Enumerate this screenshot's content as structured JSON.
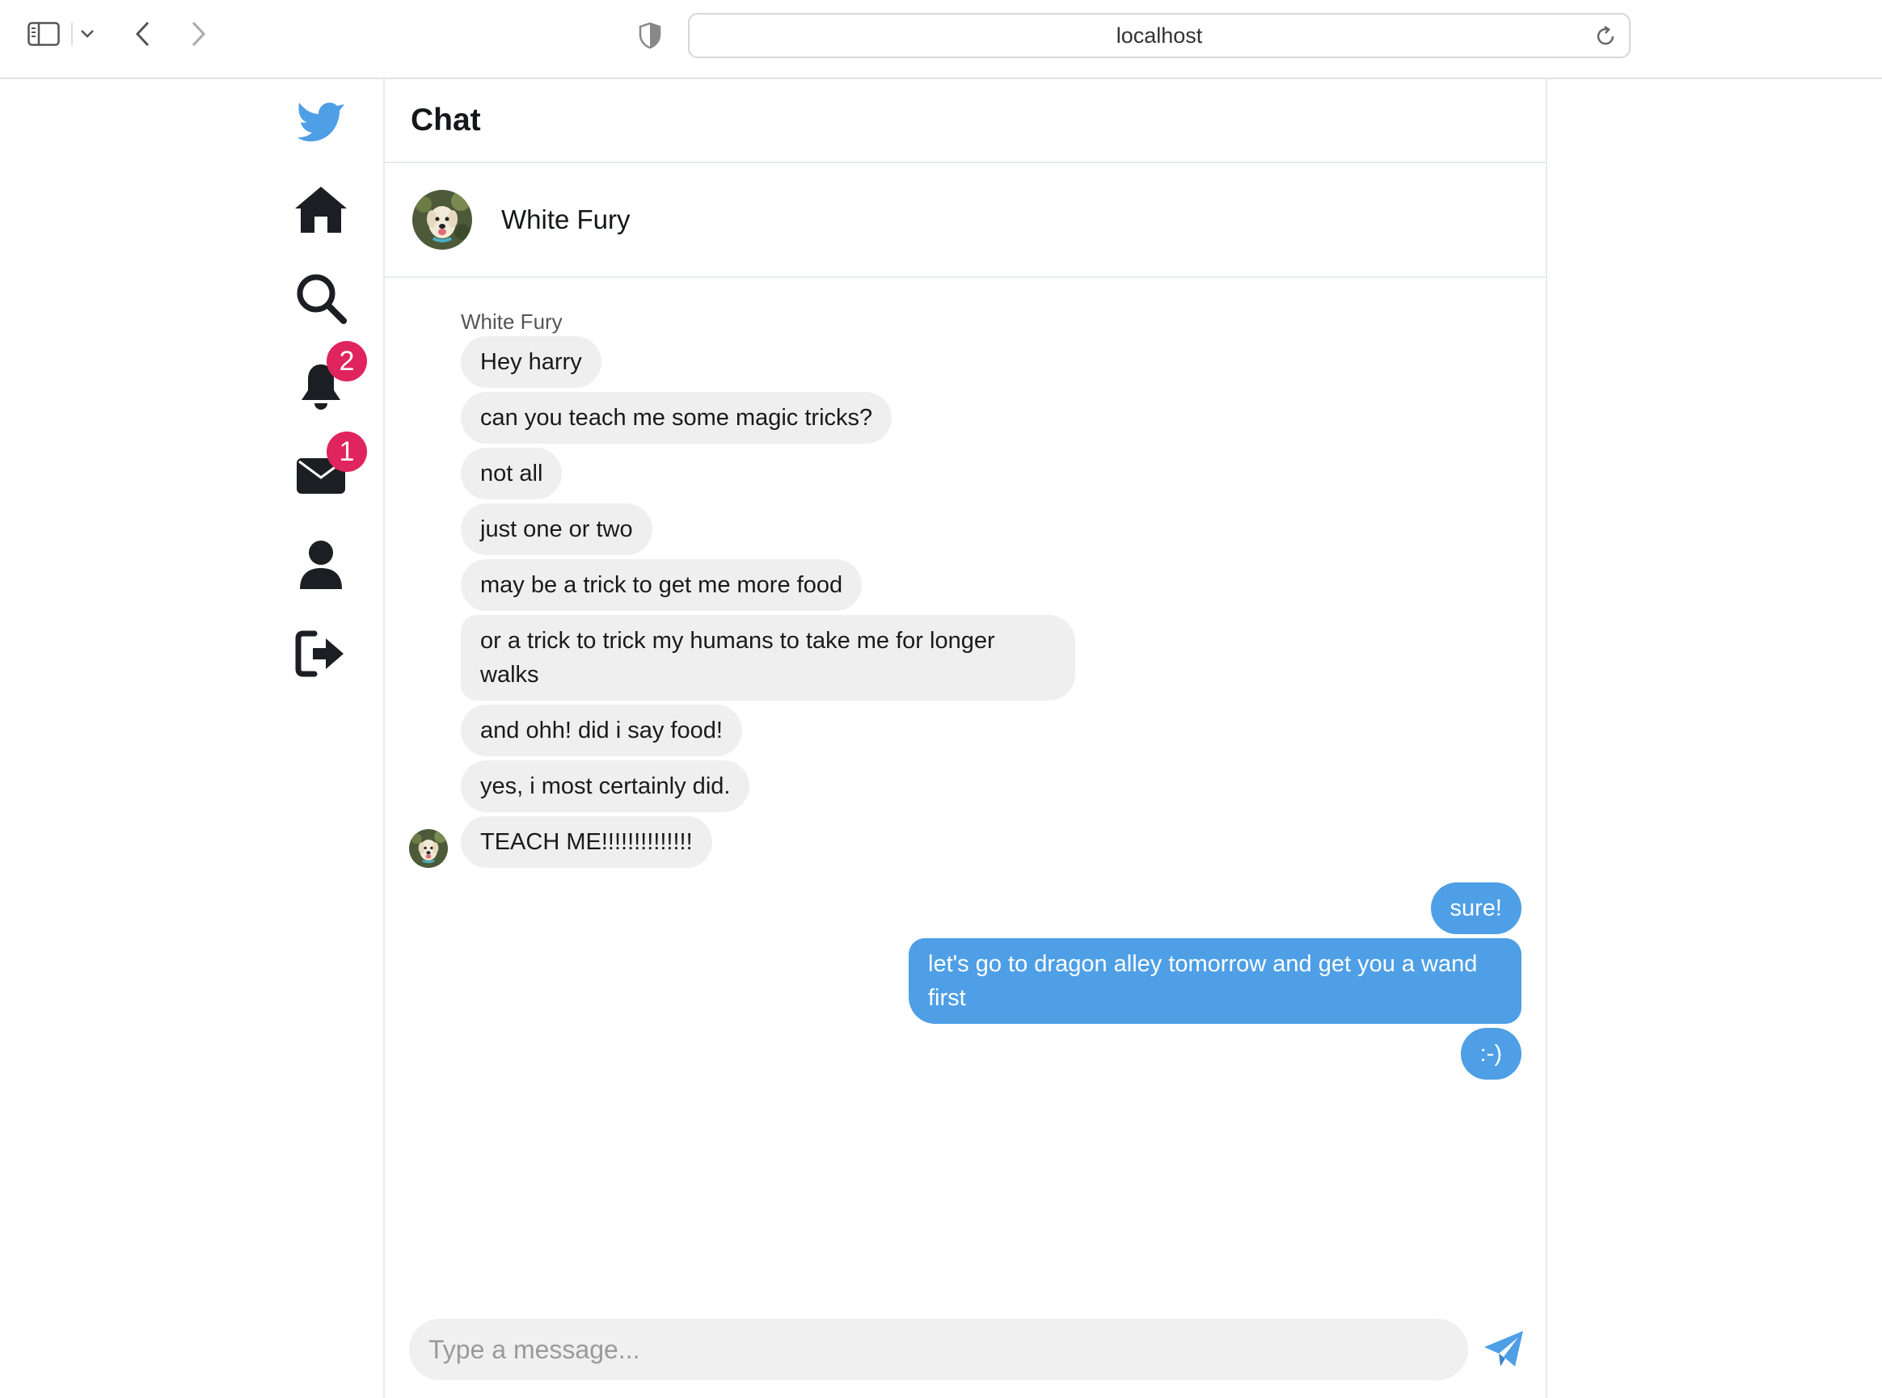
{
  "browser": {
    "url": "localhost",
    "icons": [
      "sidebar-icon",
      "chevron-down-icon",
      "back-arrow-icon",
      "forward-arrow-icon",
      "shield-icon",
      "reload-icon"
    ]
  },
  "nav": {
    "items": [
      {
        "name": "logo",
        "icon": "bird-logo-icon"
      },
      {
        "name": "home",
        "icon": "home-icon"
      },
      {
        "name": "search",
        "icon": "search-icon"
      },
      {
        "name": "notifications",
        "icon": "bell-icon",
        "badge": "2"
      },
      {
        "name": "messages",
        "icon": "envelope-icon",
        "badge": "1"
      },
      {
        "name": "profile",
        "icon": "user-icon"
      },
      {
        "name": "logout",
        "icon": "logout-icon"
      }
    ],
    "accent": "#4e9fe6",
    "badge_color": "#e0245e"
  },
  "page": {
    "title": "Chat"
  },
  "contact": {
    "name": "White Fury"
  },
  "conversation": {
    "sender_label": "White Fury",
    "incoming": [
      "Hey harry",
      "can you teach me some magic tricks?",
      "not all",
      "just one or two",
      "may be a trick to get me more food",
      "or a trick to trick my humans to take me for longer walks",
      "and ohh! did i say food!",
      "yes, i most certainly did.",
      "TEACH ME!!!!!!!!!!!!!!"
    ],
    "outgoing": [
      "sure!",
      "let's go to dragon alley tomorrow and get you a wand first",
      ":-)"
    ]
  },
  "composer": {
    "placeholder": "Type a message...",
    "value": "",
    "send_icon": "paper-plane-icon"
  }
}
